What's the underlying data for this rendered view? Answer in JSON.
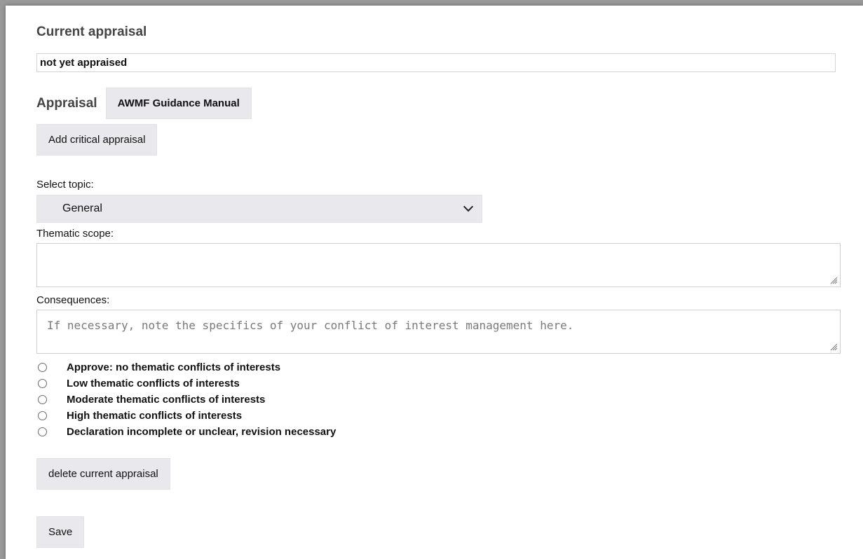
{
  "current_appraisal": {
    "title": "Current appraisal",
    "value": "not yet appraised"
  },
  "appraisal": {
    "title": "Appraisal",
    "manual_button": "AWMF Guidance Manual",
    "add_button": "Add critical appraisal"
  },
  "topic": {
    "label": "Select topic:",
    "selected": "General"
  },
  "thematic_scope": {
    "label": "Thematic scope:",
    "value": ""
  },
  "consequences": {
    "label": "Consequences:",
    "placeholder": "If necessary, note the specifics of your conflict of interest management here."
  },
  "options": [
    {
      "label": "Approve: no thematic conflicts of interests"
    },
    {
      "label": "Low thematic conflicts of interests"
    },
    {
      "label": "Moderate thematic conflicts of interests"
    },
    {
      "label": "High thematic conflicts of interests"
    },
    {
      "label": "Declaration incomplete or unclear, revision necessary"
    }
  ],
  "actions": {
    "delete_button": "delete current appraisal",
    "save_button": "Save"
  },
  "icons": {
    "select": "chevron-down-icon",
    "resize": "resize-grip-icon",
    "radio": "radio-unchecked-icon"
  }
}
